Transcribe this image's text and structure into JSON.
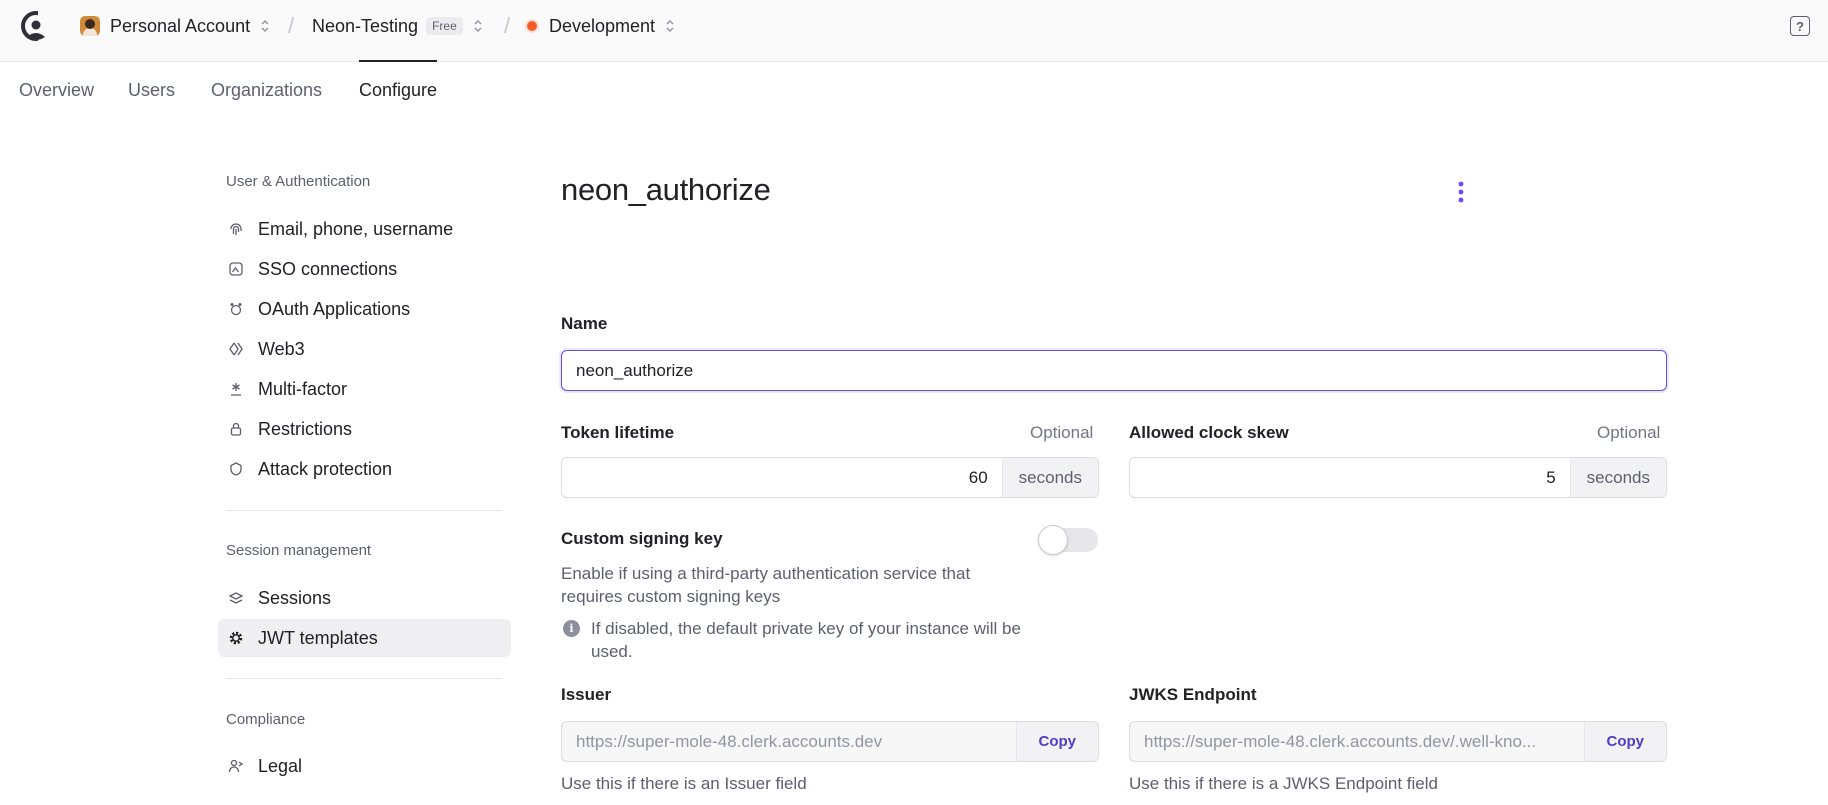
{
  "topbar": {
    "account": "Personal Account",
    "app": "Neon-Testing",
    "plan_badge": "Free",
    "environment": "Development",
    "env_color": "#f45d2a"
  },
  "tabs": [
    "Overview",
    "Users",
    "Organizations",
    "Configure"
  ],
  "active_tab": "Configure",
  "sidebar": {
    "sections": [
      {
        "heading": "User & Authentication",
        "items": [
          {
            "label": "Email, phone, username",
            "icon": "fingerprint-icon"
          },
          {
            "label": "SSO connections",
            "icon": "sso-icon"
          },
          {
            "label": "OAuth Applications",
            "icon": "oauth-icon"
          },
          {
            "label": "Web3",
            "icon": "web3-icon"
          },
          {
            "label": "Multi-factor",
            "icon": "asterisk-icon"
          },
          {
            "label": "Restrictions",
            "icon": "lock-icon"
          },
          {
            "label": "Attack protection",
            "icon": "shield-icon"
          }
        ]
      },
      {
        "heading": "Session management",
        "items": [
          {
            "label": "Sessions",
            "icon": "sessions-icon"
          },
          {
            "label": "JWT templates",
            "icon": "gear-icon",
            "active": true
          }
        ]
      },
      {
        "heading": "Compliance",
        "items": [
          {
            "label": "Legal",
            "icon": "legal-icon"
          }
        ]
      }
    ]
  },
  "main": {
    "title": "neon_authorize",
    "name": {
      "label": "Name",
      "value": "neon_authorize"
    },
    "token_lifetime": {
      "label": "Token lifetime",
      "optional": "Optional",
      "value": "60",
      "unit": "seconds"
    },
    "clock_skew": {
      "label": "Allowed clock skew",
      "optional": "Optional",
      "value": "5",
      "unit": "seconds"
    },
    "signing_key": {
      "label": "Custom signing key",
      "description": "Enable if using a third-party authentication service that requires custom signing keys",
      "note": "If disabled, the default private key of your instance will be used.",
      "enabled": false
    },
    "issuer": {
      "label": "Issuer",
      "value": "https://super-mole-48.clerk.accounts.dev",
      "copy": "Copy",
      "help": "Use this if there is an Issuer field"
    },
    "jwks": {
      "label": "JWKS Endpoint",
      "value": "https://super-mole-48.clerk.accounts.dev/.well-kno...",
      "copy": "Copy",
      "help": "Use this if there is a JWKS Endpoint field"
    }
  },
  "accent_color": "#6c47ff"
}
